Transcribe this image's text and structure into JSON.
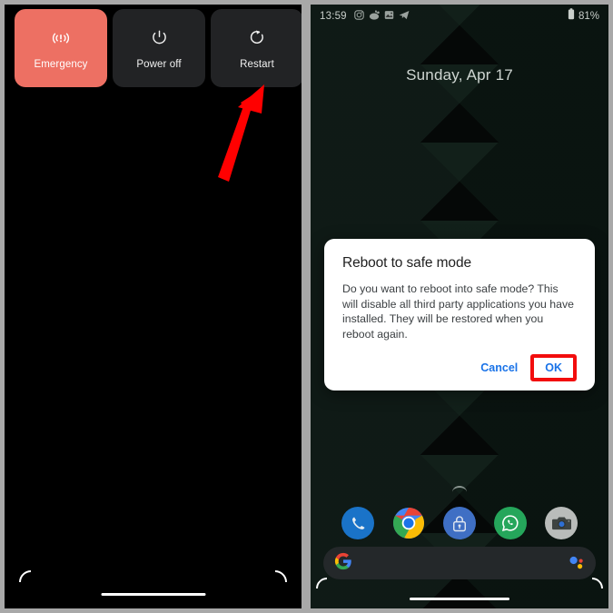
{
  "left_panel": {
    "name": "android-power-menu",
    "buttons": [
      {
        "label": "Emergency",
        "icon": "emergency-broadcast-icon",
        "color": "#ED7063"
      },
      {
        "label": "Power off",
        "icon": "power-icon",
        "color": "#222325"
      },
      {
        "label": "Restart",
        "icon": "restart-icon",
        "color": "#222325"
      }
    ],
    "annotation": {
      "type": "arrow",
      "color": "#FF0000",
      "points_to": "Restart"
    }
  },
  "right_panel": {
    "status_bar": {
      "time": "13:59",
      "battery_percent": "81%",
      "battery_icon": "battery-icon",
      "notification_icons": [
        "instagram-icon",
        "reddit-icon",
        "photo-icon",
        "telegram-icon"
      ]
    },
    "date_widget": {
      "text": "Sunday, Apr 17"
    },
    "dialog": {
      "title": "Reboot to safe mode",
      "body": "Do you want to reboot into safe mode? This will disable all third party applications you have installed. They will be restored when you reboot again.",
      "cancel_label": "Cancel",
      "ok_label": "OK",
      "accent_color": "#1A73E8",
      "highlight_color": "#F20D0D"
    },
    "dock": [
      {
        "name": "phone",
        "icon": "phone-icon",
        "color": "#1A73C8"
      },
      {
        "name": "chrome",
        "icon": "chrome-icon",
        "color": "#4285F4"
      },
      {
        "name": "vault",
        "icon": "lock-icon",
        "color": "#3F6FC4"
      },
      {
        "name": "whatsapp",
        "icon": "whatsapp-icon",
        "color": "#25A65B"
      },
      {
        "name": "camera",
        "icon": "camera-icon",
        "color": "#B9BCBA"
      }
    ],
    "search_bar": {
      "logo": "google-g-icon",
      "assistant_icon": "google-assistant-icon"
    }
  }
}
